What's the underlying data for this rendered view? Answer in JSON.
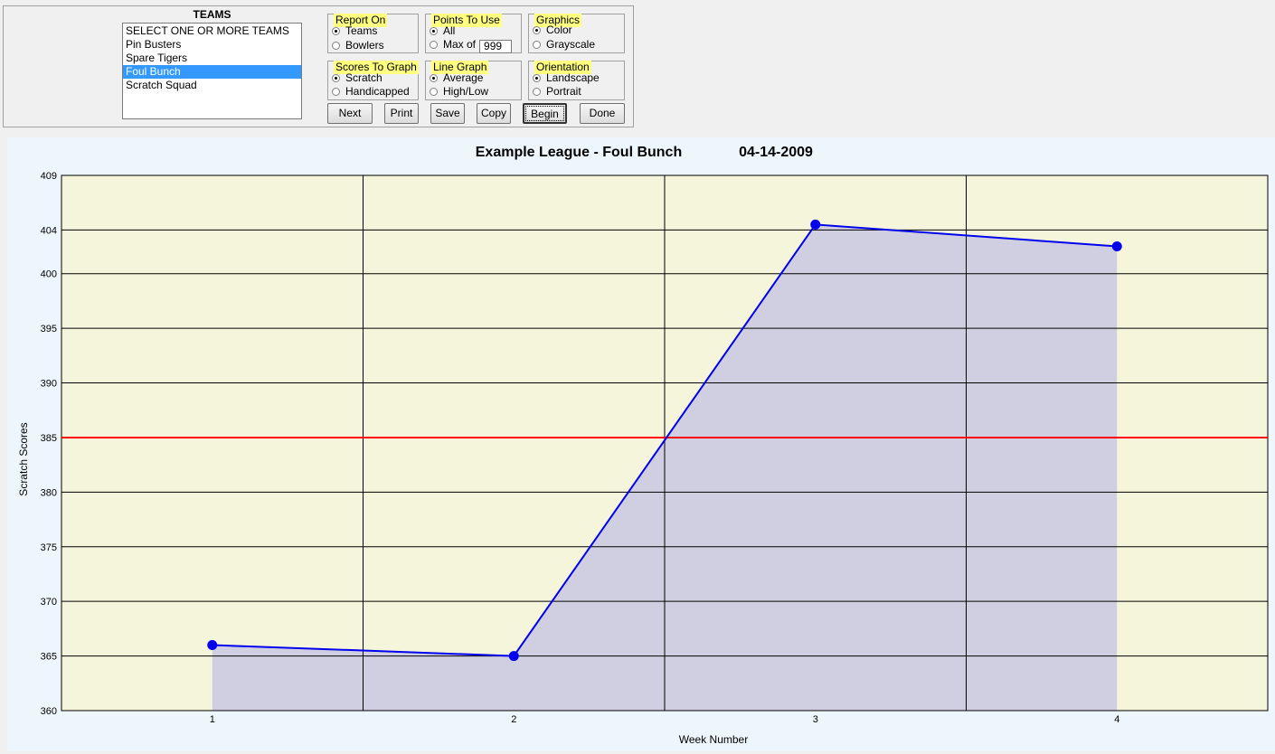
{
  "teams": {
    "title": "TEAMS",
    "items": [
      "SELECT ONE OR MORE TEAMS",
      "Pin Busters",
      "Spare Tigers",
      "Foul Bunch",
      "Scratch Squad"
    ],
    "selected_index": 3
  },
  "report_on": {
    "legend": "Report On",
    "options": [
      "Teams",
      "Bowlers"
    ],
    "selected": "Teams"
  },
  "points_to_use": {
    "legend": "Points To Use",
    "options": [
      "All",
      "Max of"
    ],
    "selected": "All",
    "max_value": "999"
  },
  "graphics": {
    "legend": "Graphics",
    "options": [
      "Color",
      "Grayscale"
    ],
    "selected": "Color"
  },
  "scores_to_graph": {
    "legend": "Scores To Graph",
    "options": [
      "Scratch",
      "Handicapped"
    ],
    "selected": "Scratch"
  },
  "line_graph": {
    "legend": "Line Graph",
    "options": [
      "Average",
      "High/Low"
    ],
    "selected": "Average"
  },
  "orientation": {
    "legend": "Orientation",
    "options": [
      "Landscape",
      "Portrait"
    ],
    "selected": "Landscape"
  },
  "buttons": {
    "next": "Next",
    "print": "Print",
    "save": "Save",
    "copy": "Copy",
    "begin": "Begin",
    "done": "Done"
  },
  "colors": {
    "plot_bg": "#f5f5dc",
    "line": "#0000ee",
    "fill": "#d0cfe2",
    "ref_line": "#ff0000"
  },
  "chart_data": {
    "type": "area",
    "title": "Example League - Foul Bunch",
    "date": "04-14-2009",
    "xlabel": "Week Number",
    "ylabel": "Scratch Scores",
    "x": [
      1,
      2,
      3,
      4
    ],
    "xlim": [
      0.5,
      4.5
    ],
    "xticks": [
      1,
      2,
      3,
      4
    ],
    "series": [
      {
        "values": [
          366,
          365,
          404.5,
          402.5
        ]
      }
    ],
    "reference_line": 385,
    "ylim": [
      360,
      409
    ],
    "yticks": [
      360,
      365,
      370,
      375,
      380,
      385,
      390,
      395,
      400,
      404,
      409
    ],
    "grid": true
  }
}
